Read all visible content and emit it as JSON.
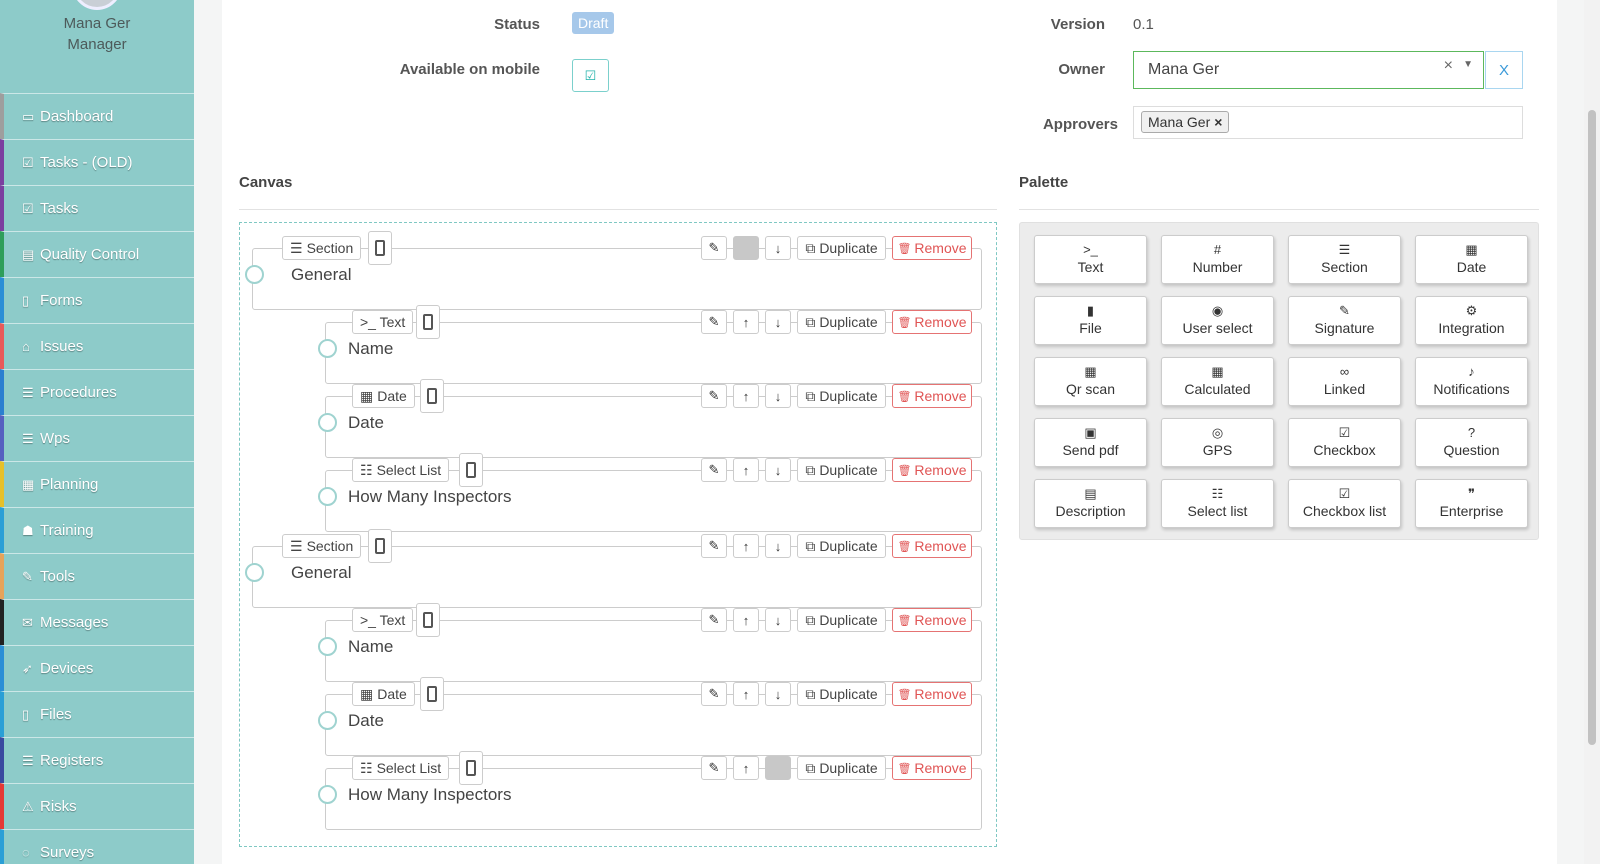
{
  "user": {
    "name": "Mana Ger",
    "role": "Manager"
  },
  "sidebar": {
    "items": [
      {
        "label": "Dashboard",
        "icon": "monitor-icon",
        "glyph": "▭",
        "accent": "#9e9e9e"
      },
      {
        "label": "Tasks - (OLD)",
        "icon": "check-square-icon",
        "glyph": "☑",
        "accent": "#7b3fa0"
      },
      {
        "label": "Tasks",
        "icon": "check-square-icon",
        "glyph": "☑",
        "accent": "#7b3fa0"
      },
      {
        "label": "Quality Control",
        "icon": "book-icon",
        "glyph": "▤",
        "accent": "#2e9e5a"
      },
      {
        "label": "Forms",
        "icon": "file-icon",
        "glyph": "▯",
        "accent": "#2a8fd6"
      },
      {
        "label": "Issues",
        "icon": "bell-icon",
        "glyph": "⌂",
        "accent": "#e85a5a"
      },
      {
        "label": "Procedures",
        "icon": "list-icon",
        "glyph": "☰",
        "accent": "#2a7fd0"
      },
      {
        "label": "Wps",
        "icon": "list-icon",
        "glyph": "☰",
        "accent": "#5560c0"
      },
      {
        "label": "Planning",
        "icon": "calendar-icon",
        "glyph": "▦",
        "accent": "#e6c02a"
      },
      {
        "label": "Training",
        "icon": "graduation-cap-icon",
        "glyph": "☗",
        "accent": "#2a9fd6"
      },
      {
        "label": "Tools",
        "icon": "wrench-icon",
        "glyph": "✎",
        "accent": "#e6a35a"
      },
      {
        "label": "Messages",
        "icon": "envelope-icon",
        "glyph": "✉",
        "accent": "#222222"
      },
      {
        "label": "Devices",
        "icon": "rocket-icon",
        "glyph": "➶",
        "accent": "#2a8fd6"
      },
      {
        "label": "Files",
        "icon": "file-pdf-icon",
        "glyph": "▯",
        "accent": "#2a9fd6"
      },
      {
        "label": "Registers",
        "icon": "list-icon",
        "glyph": "☰",
        "accent": "#3a4aa0"
      },
      {
        "label": "Risks",
        "icon": "warning-icon",
        "glyph": "⚠",
        "accent": "#e53935"
      },
      {
        "label": "Surveys",
        "icon": "comment-icon",
        "glyph": "◌",
        "accent": "#2a9fd6"
      }
    ]
  },
  "form": {
    "status_label": "Status",
    "status_value": "Draft",
    "mobile_label": "Available on mobile",
    "mobile_check": "☑",
    "version_label": "Version",
    "version_value": "0.1",
    "owner_label": "Owner",
    "owner_value": "Mana Ger",
    "owner_clear": "×",
    "owner_caret": "▼",
    "owner_button": "X",
    "approvers_label": "Approvers",
    "approvers": [
      {
        "name": "Mana Ger",
        "remove": "×"
      }
    ]
  },
  "canvas": {
    "title": "Canvas",
    "duplicate_label": "Duplicate",
    "remove_label": "Remove",
    "fields": [
      {
        "type": "Section",
        "type_icon": "☰",
        "label": "General",
        "up": false,
        "down": true
      },
      {
        "type": ">_ Text",
        "type_icon": "",
        "label": "Name",
        "up": true,
        "down": true
      },
      {
        "type": "Date",
        "type_icon": "▦",
        "label": "Date",
        "up": true,
        "down": true
      },
      {
        "type": "Select List",
        "type_icon": "☷",
        "label": "How Many Inspectors",
        "up": true,
        "down": true
      },
      {
        "type": "Section",
        "type_icon": "☰",
        "label": "General",
        "up": true,
        "down": true
      },
      {
        "type": ">_ Text",
        "type_icon": "",
        "label": "Name",
        "up": true,
        "down": true
      },
      {
        "type": "Date",
        "type_icon": "▦",
        "label": "Date",
        "up": true,
        "down": true
      },
      {
        "type": "Select List",
        "type_icon": "☷",
        "label": "How Many Inspectors",
        "up": true,
        "down": false
      }
    ]
  },
  "palette": {
    "title": "Palette",
    "items": [
      {
        "label": "Text",
        "icon": "terminal-icon",
        "glyph": ">_"
      },
      {
        "label": "Number",
        "icon": "hash-icon",
        "glyph": "#"
      },
      {
        "label": "Section",
        "icon": "list-alt-icon",
        "glyph": "☰"
      },
      {
        "label": "Date",
        "icon": "calendar-icon",
        "glyph": "▦"
      },
      {
        "label": "File",
        "icon": "file-icon",
        "glyph": "▮"
      },
      {
        "label": "User select",
        "icon": "user-circle-icon",
        "glyph": "◉"
      },
      {
        "label": "Signature",
        "icon": "pencil-square-icon",
        "glyph": "✎"
      },
      {
        "label": "Integration",
        "icon": "cogs-icon",
        "glyph": "⚙"
      },
      {
        "label": "Qr scan",
        "icon": "qrcode-icon",
        "glyph": "▦"
      },
      {
        "label": "Calculated",
        "icon": "calculator-icon",
        "glyph": "▦"
      },
      {
        "label": "Linked",
        "icon": "link-icon",
        "glyph": "∞"
      },
      {
        "label": "Notifications",
        "icon": "bell-icon",
        "glyph": "♪"
      },
      {
        "label": "Send pdf",
        "icon": "image-icon",
        "glyph": "▣"
      },
      {
        "label": "GPS",
        "icon": "compass-icon",
        "glyph": "◎"
      },
      {
        "label": "Checkbox",
        "icon": "check-square-icon",
        "glyph": "☑"
      },
      {
        "label": "Question",
        "icon": "question-circle-icon",
        "glyph": "?"
      },
      {
        "label": "Description",
        "icon": "file-text-icon",
        "glyph": "▤"
      },
      {
        "label": "Select list",
        "icon": "list-ol-icon",
        "glyph": "☷"
      },
      {
        "label": "Checkbox list",
        "icon": "check-square-icon",
        "glyph": "☑"
      },
      {
        "label": "Enterprise",
        "icon": "quote-icon",
        "glyph": "❞"
      }
    ]
  },
  "toolbar_icons": {
    "wrench": "✎",
    "up": "↑",
    "down": "↓",
    "dup": "⧉",
    "trash": "🗑"
  }
}
